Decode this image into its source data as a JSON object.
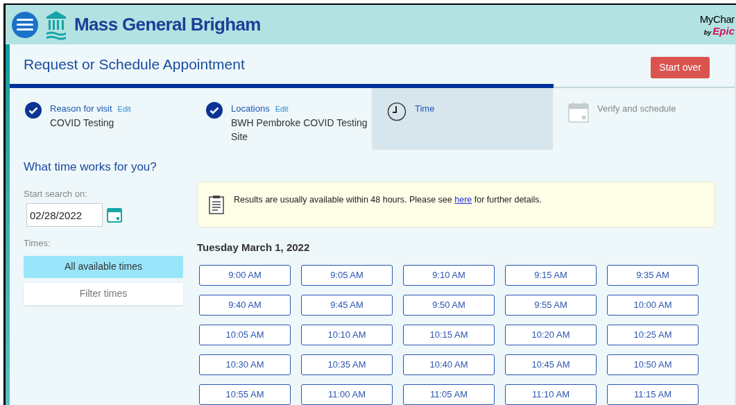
{
  "header": {
    "brand": "Mass General Brigham",
    "mychart": {
      "name": "MyChar",
      "by": "by",
      "epic": "Epic"
    }
  },
  "page": {
    "title": "Request or Schedule Appointment",
    "start_over": "Start over"
  },
  "progress": {
    "level": 0.75
  },
  "steps": [
    {
      "label": "Reason for visit",
      "edit": "Edit",
      "value": "COVID Testing",
      "kind": "done",
      "selected": false
    },
    {
      "label": "Locations",
      "edit": "Edit",
      "value": "BWH Pembroke COVID Testing Site",
      "kind": "done",
      "selected": false
    },
    {
      "label": "Time",
      "kind": "current",
      "selected": true
    },
    {
      "label": "Verify and schedule",
      "kind": "pending",
      "selected": false
    }
  ],
  "question": "What time works for you?",
  "search": {
    "label": "Start search on:",
    "value": "02/28/2022"
  },
  "times": {
    "label": "Times:",
    "options": [
      {
        "label": "All available times",
        "selected": true
      },
      {
        "label": "Filter times",
        "selected": false
      }
    ]
  },
  "notice": {
    "text": "Results are usually available within 48 hours. Please see",
    "link": "here",
    "after": "for further details."
  },
  "day": {
    "heading": "Tuesday March 1, 2022",
    "slots": [
      "9:00 AM",
      "9:05 AM",
      "9:10 AM",
      "9:15 AM",
      "9:35 AM",
      "9:40 AM",
      "9:45 AM",
      "9:50 AM",
      "9:55 AM",
      "10:00 AM",
      "10:05 AM",
      "10:10 AM",
      "10:15 AM",
      "10:20 AM",
      "10:25 AM",
      "10:30 AM",
      "10:35 AM",
      "10:40 AM",
      "10:45 AM",
      "10:50 AM",
      "10:55 AM",
      "11:00 AM",
      "11:05 AM",
      "11:10 AM",
      "11:15 AM"
    ]
  }
}
